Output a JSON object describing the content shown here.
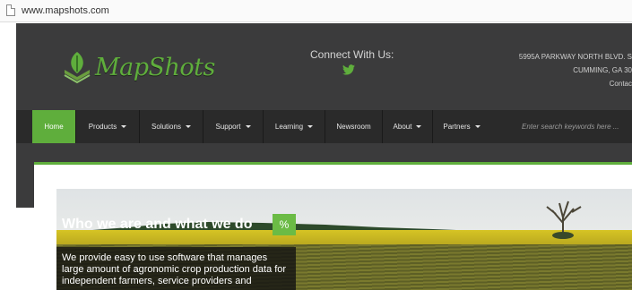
{
  "browser": {
    "url": "www.mapshots.com"
  },
  "header": {
    "logo_text": "MapShots",
    "connect_label": "Connect With Us:",
    "address_line1": "5995A PARKWAY NORTH BLVD. S",
    "address_line2": "CUMMING, GA 30",
    "contact_label": "Contac"
  },
  "nav": {
    "items": [
      {
        "label": "Home"
      },
      {
        "label": "Products"
      },
      {
        "label": "Solutions"
      },
      {
        "label": "Support"
      },
      {
        "label": "Learning"
      },
      {
        "label": "Newsroom"
      },
      {
        "label": "About"
      },
      {
        "label": "Partners"
      }
    ],
    "search_placeholder": "Enter search keywords here ..."
  },
  "hero": {
    "title": "Who we are and what we do",
    "link_icon": "%",
    "description": "We provide easy to use software that manages large amount of agronomic crop production data for independent farmers, service providers and"
  },
  "colors": {
    "accent": "#5fae3c",
    "header_bg": "#3b3b3c",
    "nav_bg": "#2a2a2a"
  },
  "icons": [
    "page-icon",
    "logo-leaf-icon",
    "twitter-icon",
    "caret-down-icon",
    "link-icon"
  ]
}
